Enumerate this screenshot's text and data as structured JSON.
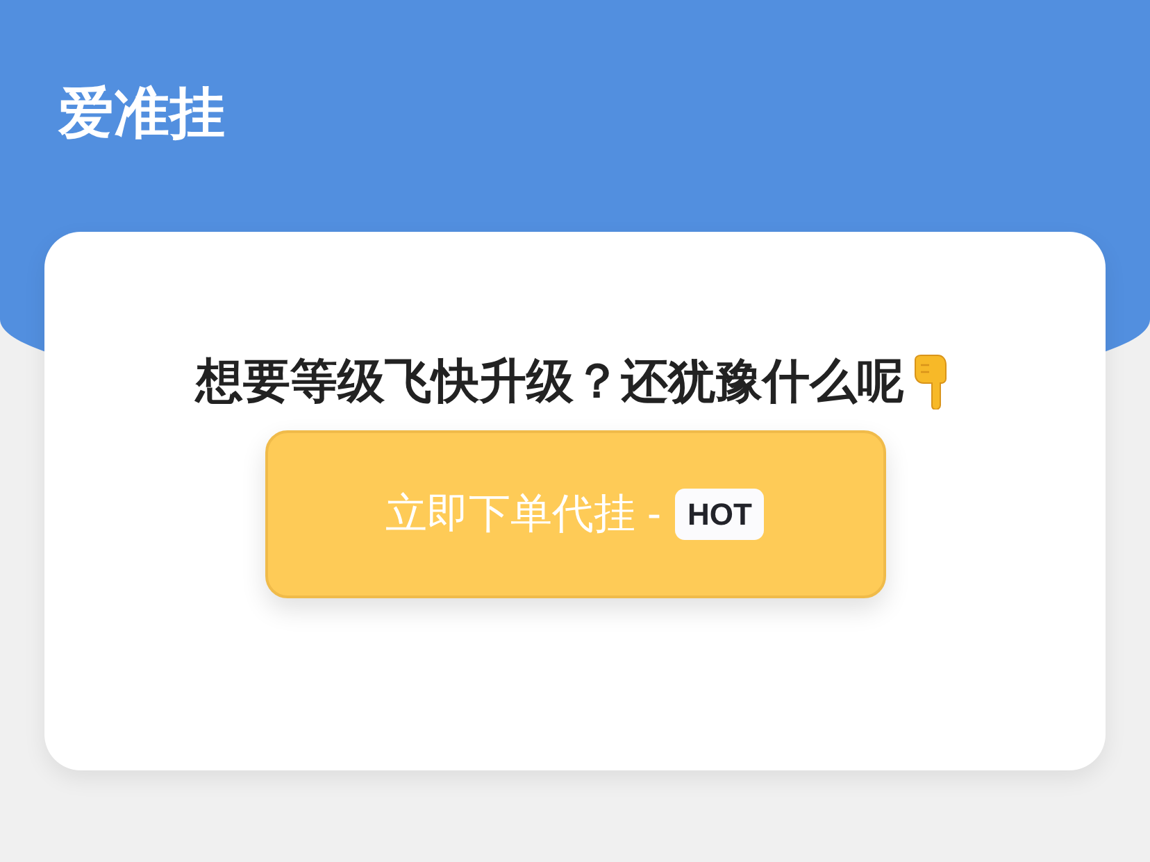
{
  "header": {
    "title": "爱准挂"
  },
  "card": {
    "headline": "想要等级飞快升级？还犹豫什么呢",
    "order_button": {
      "label": "立即下单代挂 -",
      "badge": "HOT"
    }
  }
}
